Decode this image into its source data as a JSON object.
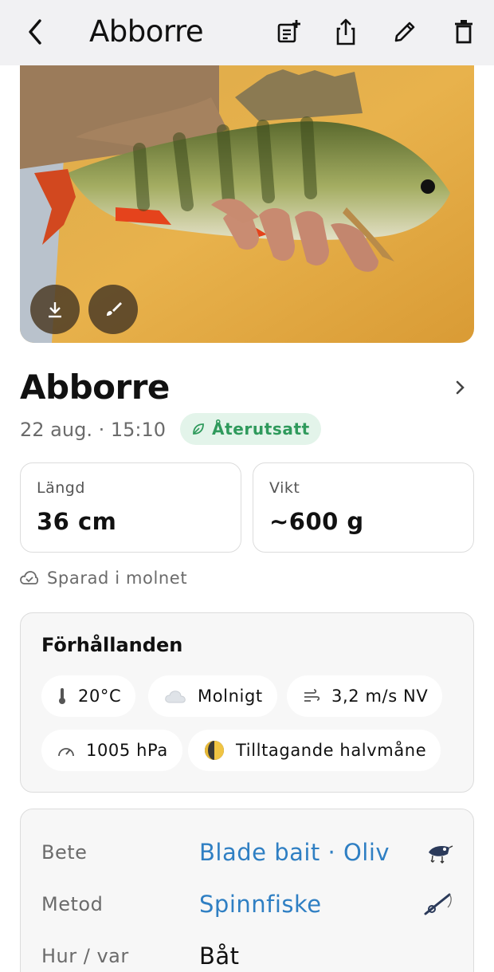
{
  "header": {
    "title": "Abborre",
    "icons": [
      "back-icon",
      "add-note-icon",
      "share-icon",
      "edit-icon",
      "trash-icon"
    ]
  },
  "photo": {
    "buttons": [
      "download-icon",
      "brush-icon"
    ]
  },
  "catch": {
    "species": "Abborre",
    "date": "22 aug. · 15:10",
    "status": "Återutsatt",
    "status_color": "#2f9a5c"
  },
  "stats": {
    "length_label": "Längd",
    "length_value": "36 cm",
    "weight_label": "Vikt",
    "weight_value": "~600 g"
  },
  "cloud": {
    "text": "Sparad i molnet"
  },
  "conditions": {
    "title": "Förhållanden",
    "temperature": "20°C",
    "sky": "Molnigt",
    "wind": "3,2 m/s NV",
    "pressure": "1005 hPa",
    "moon": "Tilltagande halvmåne"
  },
  "details": {
    "bait_label": "Bete",
    "bait_value": "Blade bait · Oliv",
    "method_label": "Metod",
    "method_value": "Spinnfiske",
    "where_label": "Hur / var",
    "where_value": "Båt",
    "link_color": "#2f7fc3"
  }
}
